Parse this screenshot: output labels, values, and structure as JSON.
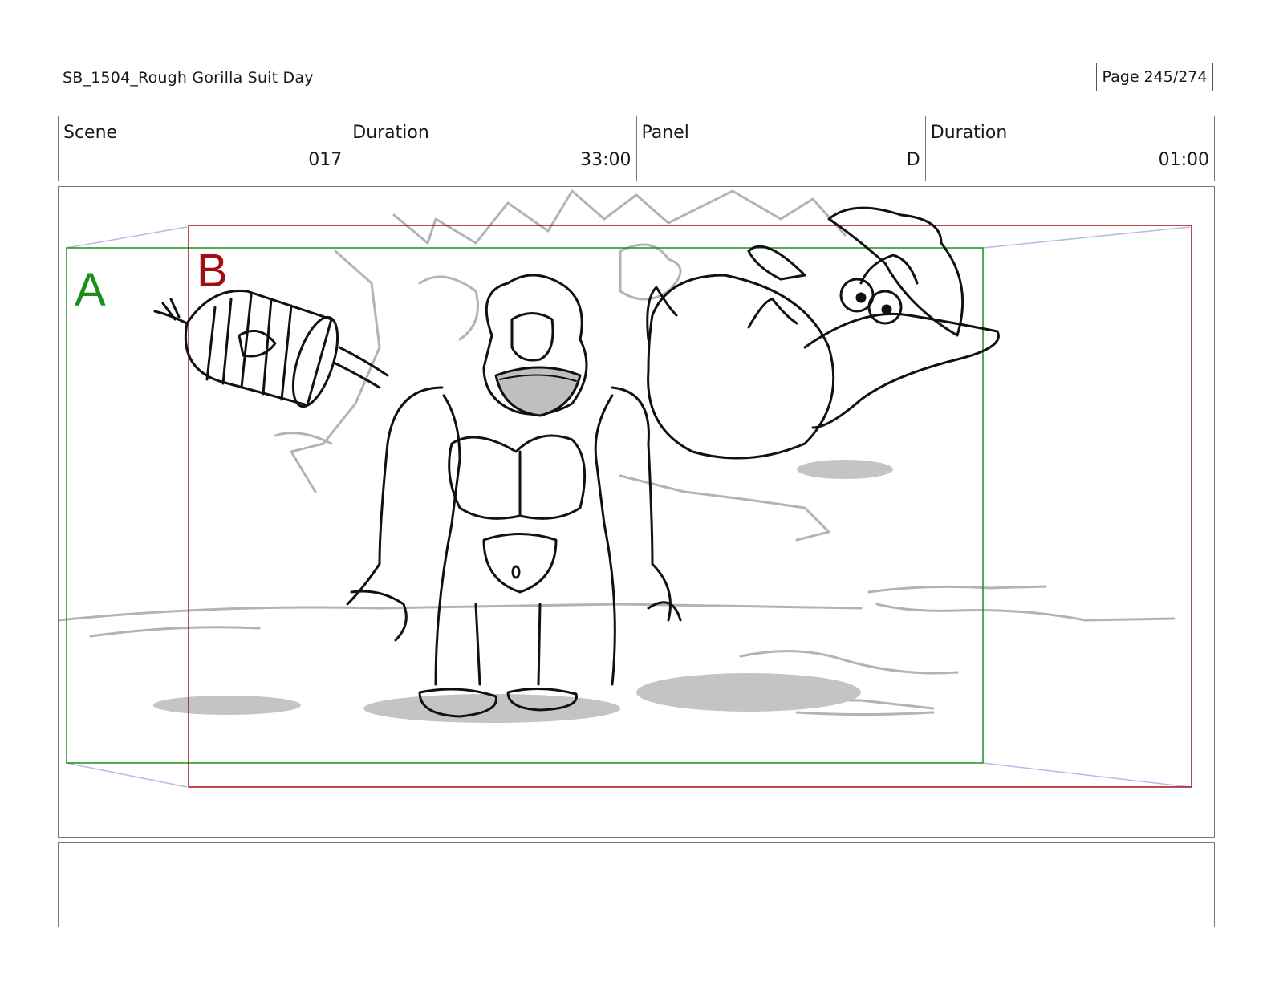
{
  "header": {
    "title": "SB_1504_Rough  Gorilla Suit Day",
    "page": "Page 245/274"
  },
  "info": {
    "scene_label": "Scene",
    "scene_value": "017",
    "scene_duration_label": "Duration",
    "scene_duration_value": "33:00",
    "panel_label": "Panel",
    "panel_value": "D",
    "panel_duration_label": "Duration",
    "panel_duration_value": "01:00"
  },
  "panel": {
    "frame_a_label": "A",
    "frame_b_label": "B",
    "frame_a_color": "#1a8f1a",
    "frame_b_color": "#a01010",
    "camera_path_color": "#b8b8e6",
    "background_sketch_color": "#b3b3b3"
  },
  "notes": {
    "text": ""
  }
}
